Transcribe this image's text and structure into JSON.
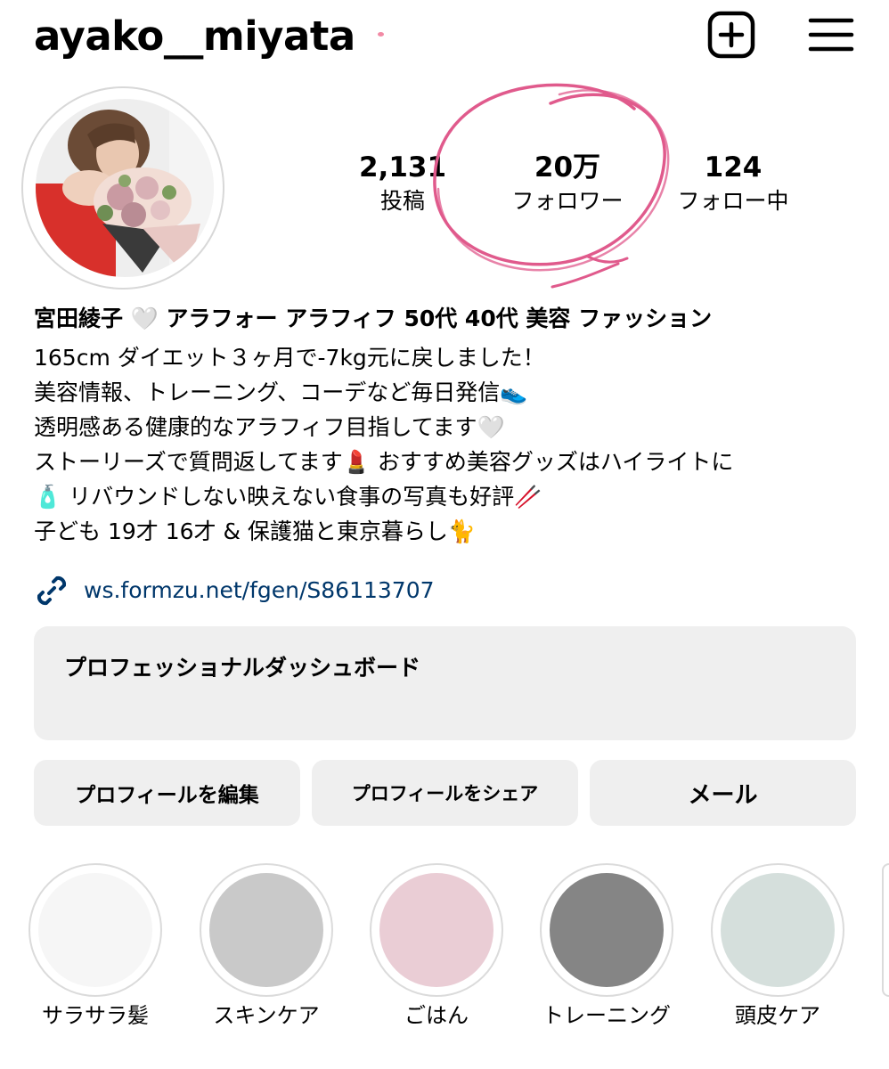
{
  "header": {
    "username": "ayako__miyata",
    "create_icon": "plus-square-icon",
    "menu_icon": "hamburger-menu-icon"
  },
  "stats": {
    "posts": {
      "value": "2,131",
      "label": "投稿"
    },
    "followers": {
      "value": "20万",
      "label": "フォロワー"
    },
    "following": {
      "value": "124",
      "label": "フォロー中"
    }
  },
  "bio": {
    "name": "宮田綾子 🤍 アラフォー アラフィフ 50代 40代 美容 ファッション",
    "lines": [
      "165cm ダイエット３ヶ月で-7kg元に戻しました！",
      "美容情報、トレーニング、コーデなど毎日発信👟",
      "透明感ある健康的なアラフィフ目指してます🤍",
      "ストーリーズで質問返してます💄 おすすめ美容グッズはハイライトに",
      "🧴 リバウンドしない映えない食事の写真も好評🥢",
      "子ども 19才 16才 & 保護猫と東京暮らし🐈"
    ],
    "link": "ws.formzu.net/fgen/S86113707",
    "link_icon": "link-icon"
  },
  "dashboard": {
    "title": "プロフェッショナルダッシュボード"
  },
  "actions": {
    "edit": "プロフィールを編集",
    "share": "プロフィールをシェア",
    "mail": "メール"
  },
  "highlights": [
    {
      "label": "サラサラ髪",
      "color": "#f6f6f6"
    },
    {
      "label": "スキンケア",
      "color": "#c9c9c9"
    },
    {
      "label": "ごはん",
      "color": "#eacdd5"
    },
    {
      "label": "トレーニング",
      "color": "#858585"
    },
    {
      "label": "頭皮ケア",
      "color": "#d5dfdc"
    }
  ],
  "colors": {
    "link": "#00376b",
    "button_bg": "#efefef",
    "annotation": "#e05a8c"
  }
}
